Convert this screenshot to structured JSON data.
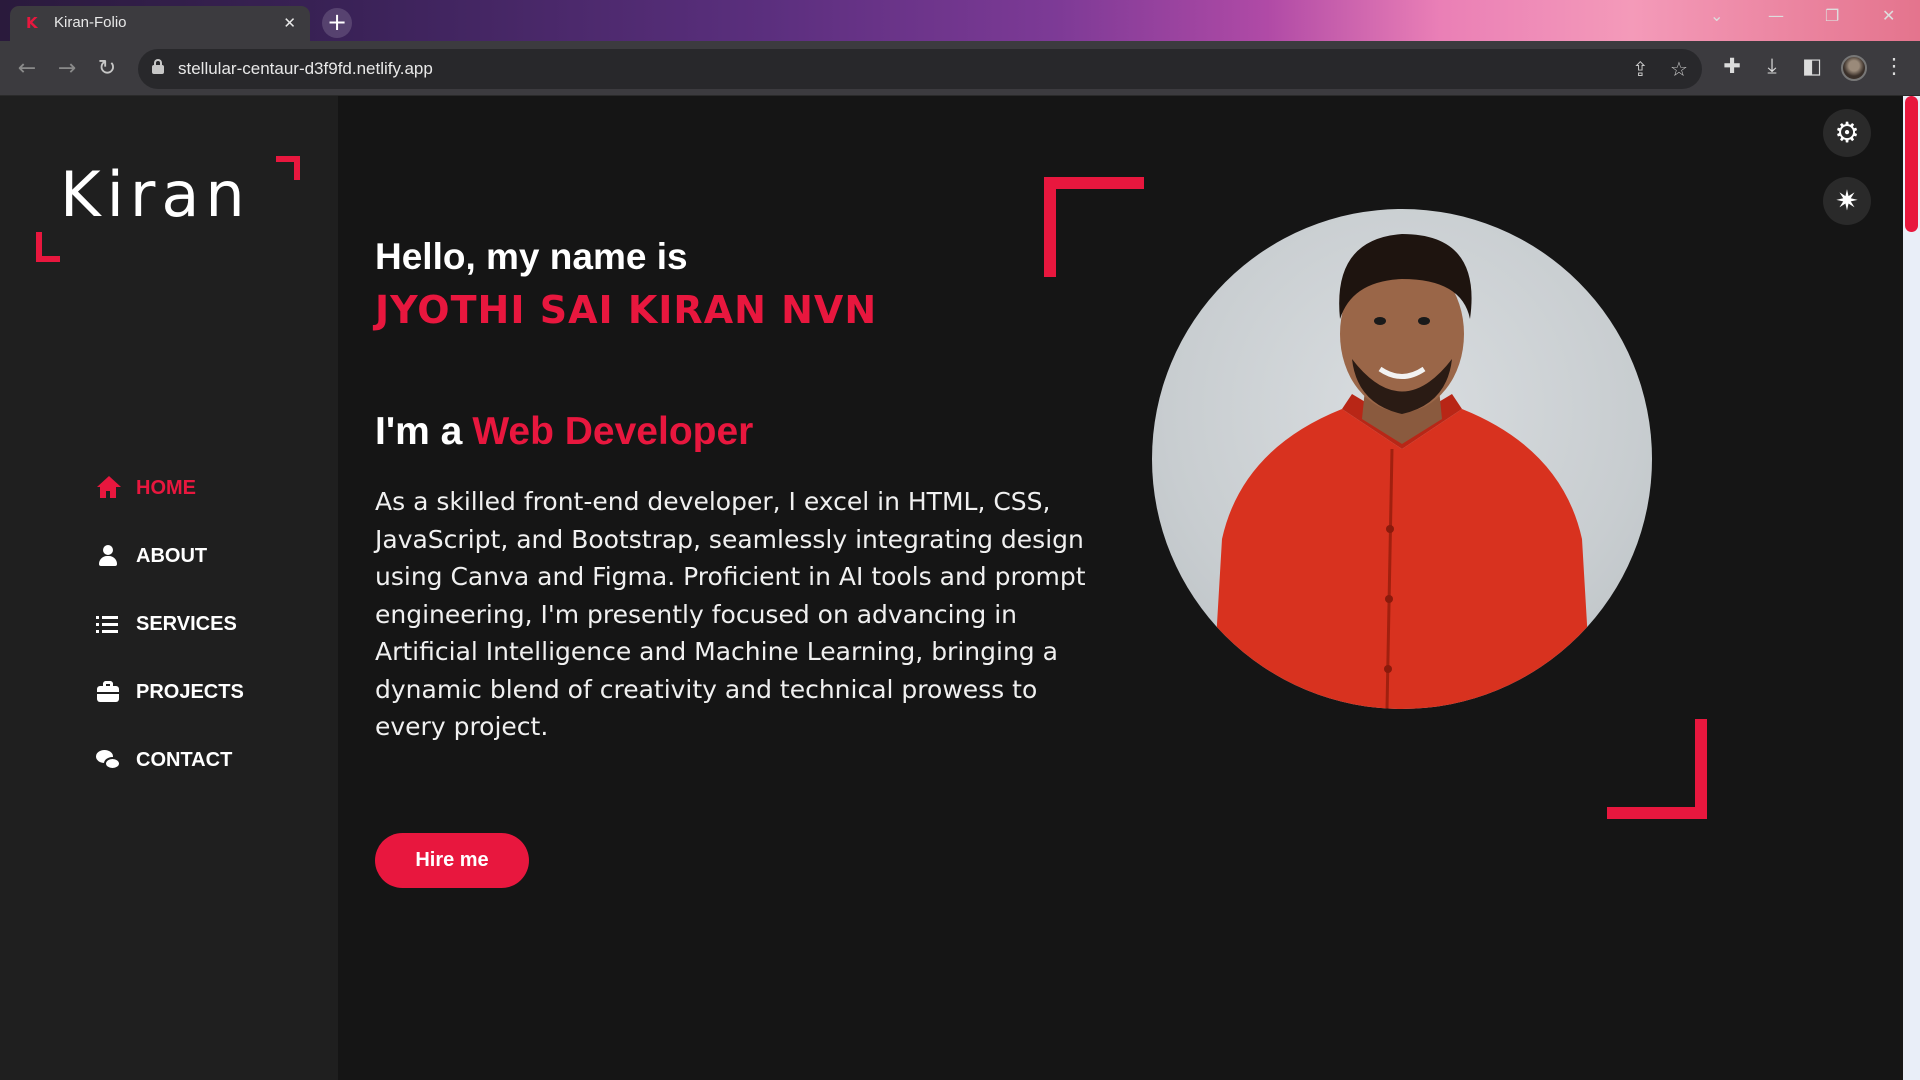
{
  "browser": {
    "tab_title": "Kiran-Folio",
    "tab_favicon": "K",
    "url": "stellular-centaur-d3f9fd.netlify.app",
    "new_tab_glyph": "+",
    "close_glyph": "✕"
  },
  "sidebar": {
    "logo": "Kiran",
    "nav": [
      {
        "label": "HOME",
        "icon": "home-icon",
        "active": true
      },
      {
        "label": "ABOUT",
        "icon": "user-icon",
        "active": false
      },
      {
        "label": "SERVICES",
        "icon": "list-icon",
        "active": false
      },
      {
        "label": "PROJECTS",
        "icon": "briefcase-icon",
        "active": false
      },
      {
        "label": "CONTACT",
        "icon": "chat-icon",
        "active": false
      }
    ]
  },
  "hero": {
    "greeting": "Hello, my name is",
    "name": "JYOTHI SAI KIRAN NVN",
    "role_prefix": "I'm a",
    "role": "Web Developer",
    "bio": "As a skilled front-end developer, I excel in HTML, CSS, JavaScript, and Bootstrap, seamlessly integrating design using Canva and Figma. Proficient in AI tools and prompt engineering, I'm presently focused on advancing in Artificial Intelligence and Machine Learning, bringing a dynamic blend of creativity and technical prowess to every project.",
    "cta": "Hire me"
  },
  "colors": {
    "accent": "#e8173e",
    "background": "#151515",
    "sidebar": "#1f1f1f"
  }
}
